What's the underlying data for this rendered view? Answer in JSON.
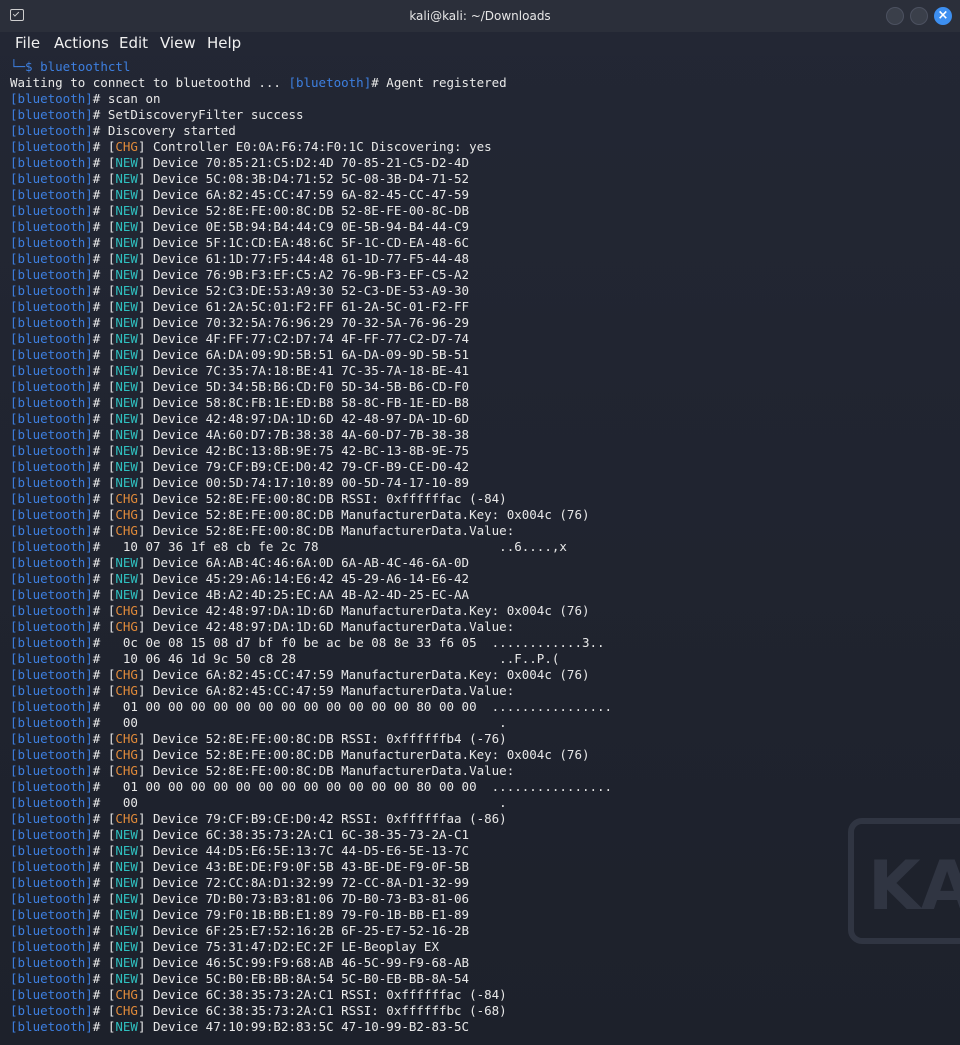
{
  "window": {
    "title": "kali@kali: ~/Downloads"
  },
  "menu": [
    "File",
    "Actions",
    "Edit",
    "View",
    "Help"
  ],
  "background_logo_text": "KALI",
  "prompt_symbol": "└─$",
  "command": "bluetoothctl",
  "bt_prefix": "[bluetooth]",
  "lines": [
    {
      "pre": "Waiting to connect to bluetoothd ... ",
      "bt": true,
      "text": "# Agent registered",
      "raw": true
    },
    {
      "text": "# scan on"
    },
    {
      "text": "# SetDiscoveryFilter success"
    },
    {
      "text": "# Discovery started"
    },
    {
      "tag": "CHG",
      "text": "Controller E0:0A:F6:74:F0:1C Discovering: yes"
    },
    {
      "tag": "NEW",
      "text": "Device 70:85:21:C5:D2:4D 70-85-21-C5-D2-4D"
    },
    {
      "tag": "NEW",
      "text": "Device 5C:08:3B:D4:71:52 5C-08-3B-D4-71-52"
    },
    {
      "tag": "NEW",
      "text": "Device 6A:82:45:CC:47:59 6A-82-45-CC-47-59"
    },
    {
      "tag": "NEW",
      "text": "Device 52:8E:FE:00:8C:DB 52-8E-FE-00-8C-DB"
    },
    {
      "tag": "NEW",
      "text": "Device 0E:5B:94:B4:44:C9 0E-5B-94-B4-44-C9"
    },
    {
      "tag": "NEW",
      "text": "Device 5F:1C:CD:EA:48:6C 5F-1C-CD-EA-48-6C"
    },
    {
      "tag": "NEW",
      "text": "Device 61:1D:77:F5:44:48 61-1D-77-F5-44-48"
    },
    {
      "tag": "NEW",
      "text": "Device 76:9B:F3:EF:C5:A2 76-9B-F3-EF-C5-A2"
    },
    {
      "tag": "NEW",
      "text": "Device 52:C3:DE:53:A9:30 52-C3-DE-53-A9-30"
    },
    {
      "tag": "NEW",
      "text": "Device 61:2A:5C:01:F2:FF 61-2A-5C-01-F2-FF"
    },
    {
      "tag": "NEW",
      "text": "Device 70:32:5A:76:96:29 70-32-5A-76-96-29"
    },
    {
      "tag": "NEW",
      "text": "Device 4F:FF:77:C2:D7:74 4F-FF-77-C2-D7-74"
    },
    {
      "tag": "NEW",
      "text": "Device 6A:DA:09:9D:5B:51 6A-DA-09-9D-5B-51"
    },
    {
      "tag": "NEW",
      "text": "Device 7C:35:7A:18:BE:41 7C-35-7A-18-BE-41"
    },
    {
      "tag": "NEW",
      "text": "Device 5D:34:5B:B6:CD:F0 5D-34-5B-B6-CD-F0"
    },
    {
      "tag": "NEW",
      "text": "Device 58:8C:FB:1E:ED:B8 58-8C-FB-1E-ED-B8"
    },
    {
      "tag": "NEW",
      "text": "Device 42:48:97:DA:1D:6D 42-48-97-DA-1D-6D"
    },
    {
      "tag": "NEW",
      "text": "Device 4A:60:D7:7B:38:38 4A-60-D7-7B-38-38"
    },
    {
      "tag": "NEW",
      "text": "Device 42:BC:13:8B:9E:75 42-BC-13-8B-9E-75"
    },
    {
      "tag": "NEW",
      "text": "Device 79:CF:B9:CE:D0:42 79-CF-B9-CE-D0-42"
    },
    {
      "tag": "NEW",
      "text": "Device 00:5D:74:17:10:89 00-5D-74-17-10-89"
    },
    {
      "tag": "CHG",
      "text": "Device 52:8E:FE:00:8C:DB RSSI: 0xffffffac (-84)"
    },
    {
      "tag": "CHG",
      "text": "Device 52:8E:FE:00:8C:DB ManufacturerData.Key: 0x004c (76)"
    },
    {
      "tag": "CHG",
      "text": "Device 52:8E:FE:00:8C:DB ManufacturerData.Value:"
    },
    {
      "text": "#   10 07 36 1f e8 cb fe 2c 78                        ..6....,x"
    },
    {
      "tag": "NEW",
      "text": "Device 6A:AB:4C:46:6A:0D 6A-AB-4C-46-6A-0D"
    },
    {
      "tag": "NEW",
      "text": "Device 45:29:A6:14:E6:42 45-29-A6-14-E6-42"
    },
    {
      "tag": "NEW",
      "text": "Device 4B:A2:4D:25:EC:AA 4B-A2-4D-25-EC-AA"
    },
    {
      "tag": "CHG",
      "text": "Device 42:48:97:DA:1D:6D ManufacturerData.Key: 0x004c (76)"
    },
    {
      "tag": "CHG",
      "text": "Device 42:48:97:DA:1D:6D ManufacturerData.Value:"
    },
    {
      "text": "#   0c 0e 08 15 08 d7 bf f0 be ac be 08 8e 33 f6 05  ............3.."
    },
    {
      "text": "#   10 06 46 1d 9c 50 c8 28                           ..F..P.("
    },
    {
      "tag": "CHG",
      "text": "Device 6A:82:45:CC:47:59 ManufacturerData.Key: 0x004c (76)"
    },
    {
      "tag": "CHG",
      "text": "Device 6A:82:45:CC:47:59 ManufacturerData.Value:"
    },
    {
      "text": "#   01 00 00 00 00 00 00 00 00 00 00 00 00 80 00 00  ................"
    },
    {
      "text": "#   00                                                ."
    },
    {
      "tag": "CHG",
      "text": "Device 52:8E:FE:00:8C:DB RSSI: 0xffffffb4 (-76)"
    },
    {
      "tag": "CHG",
      "text": "Device 52:8E:FE:00:8C:DB ManufacturerData.Key: 0x004c (76)"
    },
    {
      "tag": "CHG",
      "text": "Device 52:8E:FE:00:8C:DB ManufacturerData.Value:"
    },
    {
      "text": "#   01 00 00 00 00 00 00 00 00 00 00 00 00 80 00 00  ................"
    },
    {
      "text": "#   00                                                ."
    },
    {
      "tag": "CHG",
      "text": "Device 79:CF:B9:CE:D0:42 RSSI: 0xffffffaa (-86)"
    },
    {
      "tag": "NEW",
      "text": "Device 6C:38:35:73:2A:C1 6C-38-35-73-2A-C1"
    },
    {
      "tag": "NEW",
      "text": "Device 44:D5:E6:5E:13:7C 44-D5-E6-5E-13-7C"
    },
    {
      "tag": "NEW",
      "text": "Device 43:BE:DE:F9:0F:5B 43-BE-DE-F9-0F-5B"
    },
    {
      "tag": "NEW",
      "text": "Device 72:CC:8A:D1:32:99 72-CC-8A-D1-32-99"
    },
    {
      "tag": "NEW",
      "text": "Device 7D:B0:73:B3:81:06 7D-B0-73-B3-81-06"
    },
    {
      "tag": "NEW",
      "text": "Device 79:F0:1B:BB:E1:89 79-F0-1B-BB-E1-89"
    },
    {
      "tag": "NEW",
      "text": "Device 6F:25:E7:52:16:2B 6F-25-E7-52-16-2B"
    },
    {
      "tag": "NEW",
      "text": "Device 75:31:47:D2:EC:2F LE-Beoplay EX"
    },
    {
      "tag": "NEW",
      "text": "Device 46:5C:99:F9:68:AB 46-5C-99-F9-68-AB"
    },
    {
      "tag": "NEW",
      "text": "Device 5C:B0:EB:BB:8A:54 5C-B0-EB-BB-8A-54"
    },
    {
      "tag": "CHG",
      "text": "Device 6C:38:35:73:2A:C1 RSSI: 0xffffffac (-84)"
    },
    {
      "tag": "CHG",
      "text": "Device 6C:38:35:73:2A:C1 RSSI: 0xffffffbc (-68)"
    },
    {
      "tag": "NEW",
      "text": "Device 47:10:99:B2:83:5C 47-10-99-B2-83-5C"
    }
  ]
}
